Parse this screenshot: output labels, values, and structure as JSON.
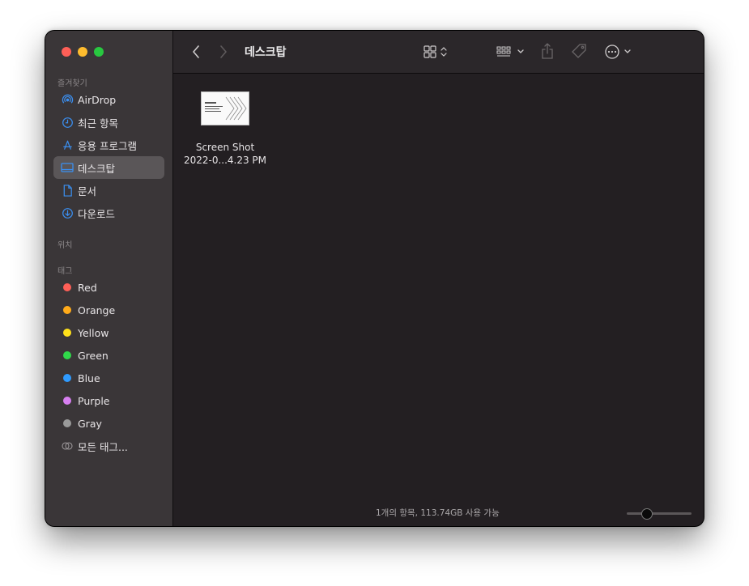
{
  "window": {
    "title": "데스크탑"
  },
  "sidebar": {
    "favorites_title": "즐겨찾기",
    "favorites": [
      {
        "label": "AirDrop",
        "icon": "airdrop-icon"
      },
      {
        "label": "최근 항목",
        "icon": "clock-icon"
      },
      {
        "label": "응용 프로그램",
        "icon": "apps-icon"
      },
      {
        "label": "데스크탑",
        "icon": "desktop-icon",
        "selected": true
      },
      {
        "label": "문서",
        "icon": "document-icon"
      },
      {
        "label": "다운로드",
        "icon": "download-icon"
      }
    ],
    "locations_title": "위치",
    "tags_title": "태그",
    "tags": [
      {
        "label": "Red",
        "color": "#ff5f57"
      },
      {
        "label": "Orange",
        "color": "#ffab1a"
      },
      {
        "label": "Yellow",
        "color": "#ffe11a"
      },
      {
        "label": "Green",
        "color": "#30d94a"
      },
      {
        "label": "Blue",
        "color": "#2f9bff"
      },
      {
        "label": "Purple",
        "color": "#d77ff0"
      },
      {
        "label": "Gray",
        "color": "#9a9a9a"
      }
    ],
    "all_tags_label": "모든 태그..."
  },
  "files": [
    {
      "name_line1": "Screen Shot",
      "name_line2": "2022-0...4.23 PM",
      "icon": "screenshot-thumbnail"
    }
  ],
  "status": {
    "text": "1개의 항목, 113.74GB 사용 가능",
    "zoom": 0.28
  }
}
